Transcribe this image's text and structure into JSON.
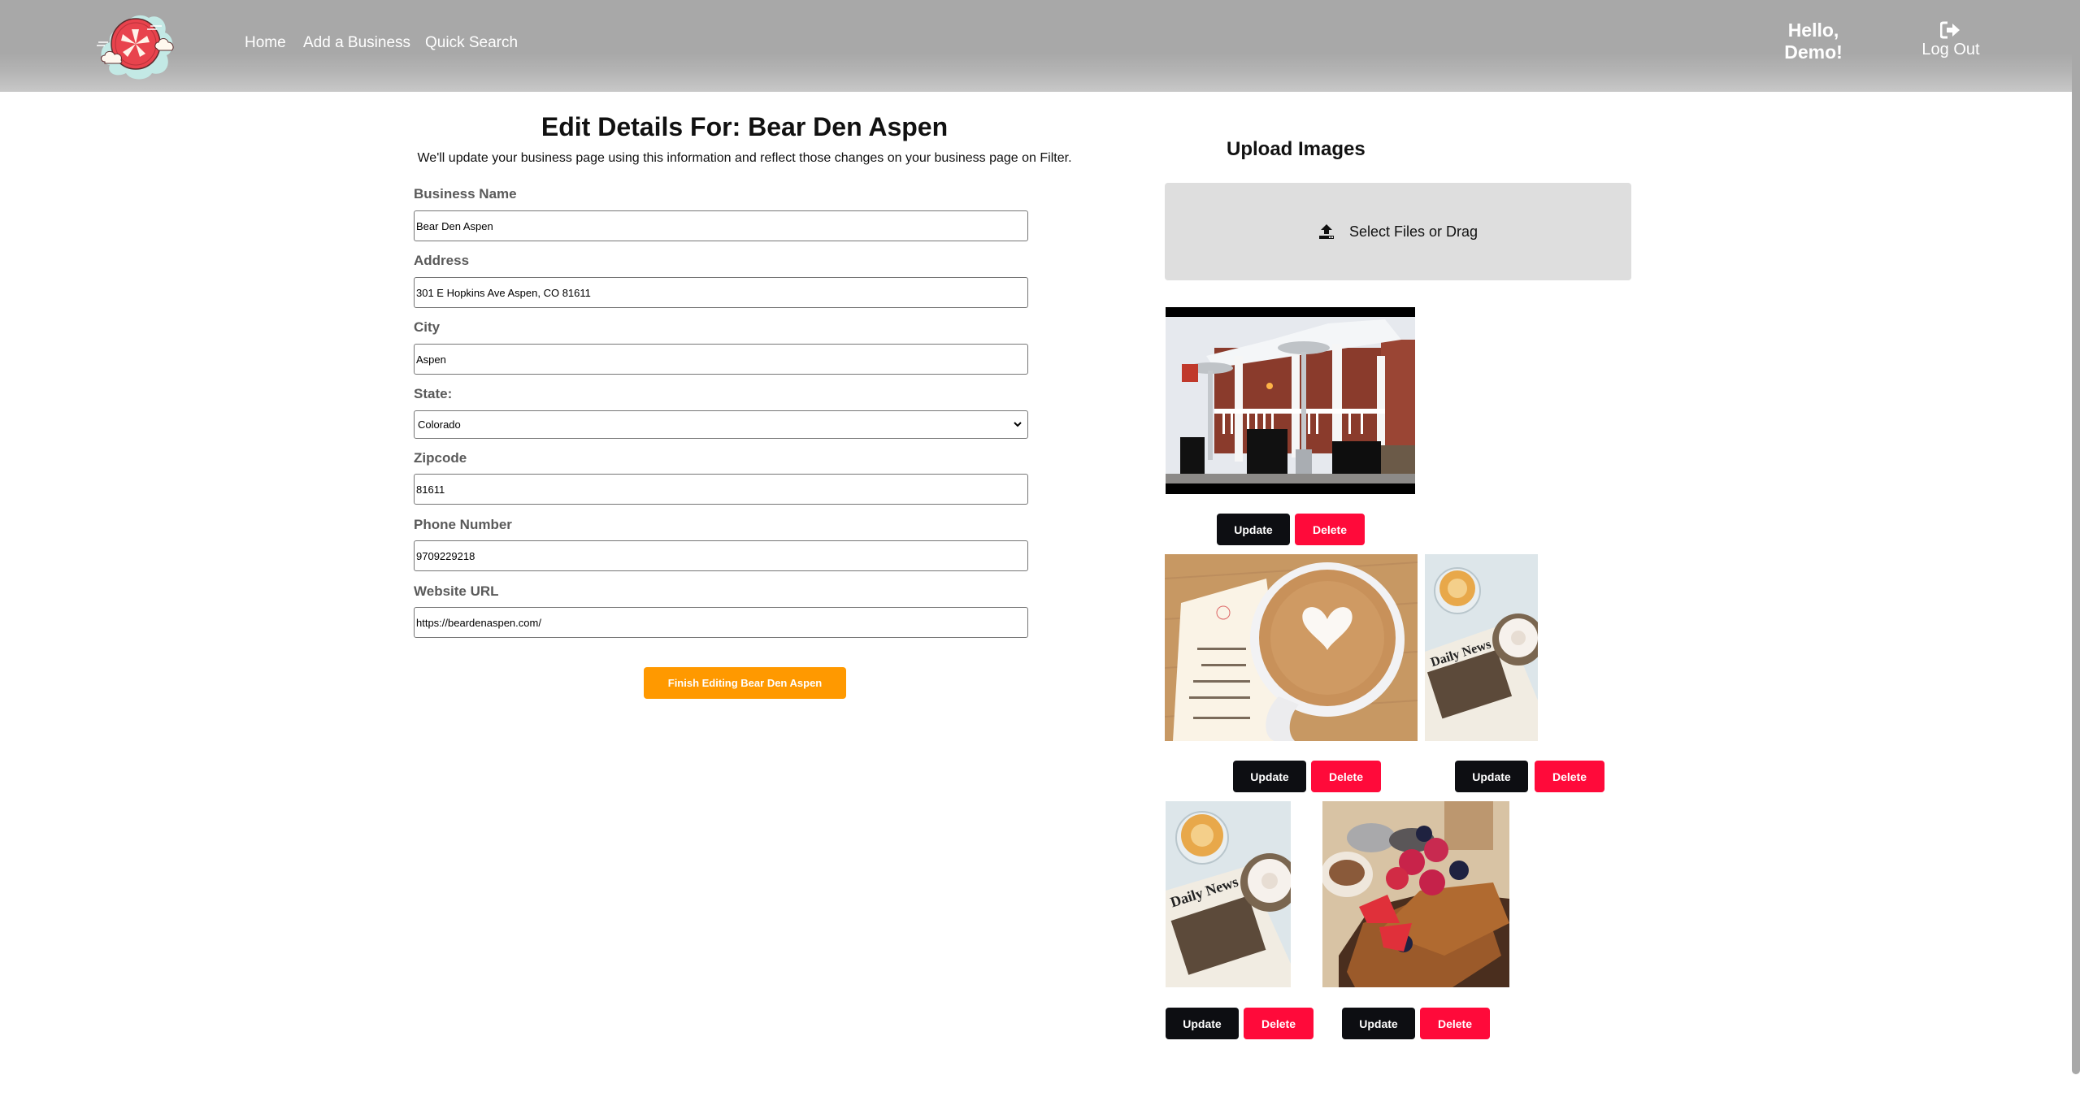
{
  "header": {
    "logo_alt": "Filter logo",
    "nav": [
      {
        "label": "Home"
      },
      {
        "label": "Add a Business"
      },
      {
        "label": "Quick Search"
      }
    ],
    "greeting_line1": "Hello,",
    "greeting_line2": "Demo!",
    "logout_label": "Log Out",
    "logout_icon": "sign-out-icon"
  },
  "form": {
    "title": "Edit Details For: Bear Den Aspen",
    "subtitle": "We'll update your business page using this information and reflect those changes on your business page on Filter.",
    "fields": {
      "business_name": {
        "label": "Business Name",
        "value": "Bear Den Aspen"
      },
      "address": {
        "label": "Address",
        "value": "301 E Hopkins Ave Aspen, CO 81611"
      },
      "city": {
        "label": "City",
        "value": "Aspen"
      },
      "state": {
        "label": "State:",
        "value": "Colorado"
      },
      "zipcode": {
        "label": "Zipcode",
        "value": "81611"
      },
      "phone": {
        "label": "Phone Number",
        "value": "9709229218"
      },
      "website": {
        "label": "Website URL",
        "value": "https://beardenaspen.com/"
      }
    },
    "submit_label": "Finish Editing Bear Den Aspen"
  },
  "upload": {
    "title": "Upload Images",
    "dropzone_label": "Select Files or Drag",
    "dropzone_icon": "upload-icon"
  },
  "images": [
    {
      "alt": "Bear Den Aspen storefront porch in snow",
      "update_label": "Update",
      "delete_label": "Delete"
    },
    {
      "alt": "Latte with heart art next to menu",
      "update_label": "Update",
      "delete_label": "Delete"
    },
    {
      "alt": "Coffee and cinnamon roll on newspaper",
      "update_label": "Update",
      "delete_label": "Delete"
    },
    {
      "alt": "Coffee and cinnamon roll on newspaper",
      "update_label": "Update",
      "delete_label": "Delete"
    },
    {
      "alt": "French toast with berries",
      "update_label": "Update",
      "delete_label": "Delete"
    }
  ],
  "colors": {
    "header_bg": "#a8a8a8",
    "primary_orange": "#ff9900",
    "update_button": "#0d0e12",
    "delete_button": "#ff0a3a",
    "dropzone_bg": "#dedede"
  }
}
